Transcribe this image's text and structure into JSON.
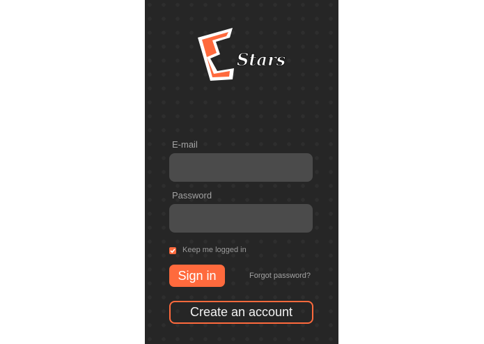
{
  "logo": {
    "mark": "E",
    "wordmark": "Stars"
  },
  "form": {
    "email_label": "E-mail",
    "email_value": "",
    "password_label": "Password",
    "password_value": "",
    "keep_logged_in_label": "Keep me logged in",
    "keep_logged_in_checked": true,
    "sign_in_label": "Sign in",
    "forgot_password_label": "Forgot password?",
    "create_account_label": "Create an account"
  },
  "colors": {
    "accent": "#ff6a3d",
    "background": "#262626",
    "field": "#4b4b4b"
  },
  "icons": [
    "estars-logo",
    "checkmark-icon"
  ]
}
